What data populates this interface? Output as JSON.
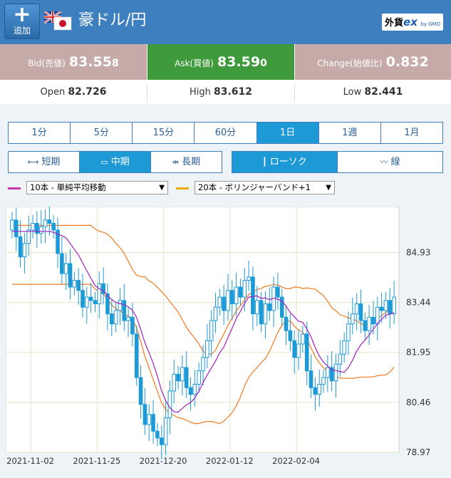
{
  "header": {
    "add_label": "追加",
    "pair_title": "豪ドル/円",
    "logo_main": "外貨",
    "logo_ex": "ex",
    "logo_sub": "by GMO"
  },
  "quote": {
    "bid_label": "Bid(売値)",
    "bid_main": "83.55",
    "bid_small": "8",
    "ask_label": "Ask(買値)",
    "ask_main": "83.59",
    "ask_small": "0",
    "change_label": "Change(始値比)",
    "change_value": "0.832"
  },
  "ohl": {
    "open_label": "Open",
    "open_value": "82.726",
    "high_label": "High",
    "high_value": "83.612",
    "low_label": "Low",
    "low_value": "82.441"
  },
  "timeframes": [
    "1分",
    "5分",
    "15分",
    "60分",
    "1日",
    "1週",
    "1月"
  ],
  "active_timeframe": 4,
  "spans": [
    "短期",
    "中期",
    "長期"
  ],
  "active_span": 1,
  "styles": [
    "ローソク",
    "線"
  ],
  "active_style": 0,
  "indicators": {
    "ma_label": "10本 - 単純平均移動",
    "bb_label": "20本 - ボリンジャーバンド+1",
    "ma_color": "#cc33aa",
    "bb_color": "#f0a800"
  },
  "colors": {
    "header_blue": "#3d7fbf",
    "bid_bg": "#c6aaa8",
    "ask_bg": "#3e9a3a",
    "active_blue": "#1d9ad6",
    "candle": "#1d9ad6",
    "ma_line": "#a020c0",
    "bb_line": "#f07a20"
  },
  "chart_data": {
    "type": "candlestick",
    "y_ticks": [
      "84.93",
      "83.44",
      "81.95",
      "80.46",
      "78.97"
    ],
    "x_ticks": [
      "2021-11-02",
      "2021-11-25",
      "2021-12-20",
      "2022-01-12",
      "2022-02-04"
    ],
    "ylim": [
      78.97,
      86.3
    ],
    "closes": [
      85.9,
      85.4,
      84.8,
      85.2,
      85.6,
      85.8,
      85.5,
      85.7,
      85.9,
      85.8,
      85.6,
      84.9,
      84.3,
      84.6,
      83.9,
      84.1,
      83.8,
      83.3,
      83.6,
      83.5,
      83.4,
      84.0,
      83.7,
      83.1,
      82.8,
      83.2,
      83.5,
      82.9,
      83.0,
      82.5,
      81.2,
      80.4,
      79.8,
      80.1,
      79.6,
      79.4,
      79.2,
      80.0,
      80.8,
      81.3,
      81.1,
      81.5,
      80.9,
      80.7,
      81.0,
      81.4,
      81.8,
      82.3,
      82.9,
      83.3,
      83.6,
      83.2,
      83.8,
      83.4,
      83.9,
      83.6,
      84.1,
      84.2,
      83.1,
      83.5,
      82.8,
      83.4,
      83.2,
      83.9,
      83.6,
      83.0,
      82.6,
      82.3,
      81.8,
      82.2,
      82.5,
      81.4,
      80.9,
      80.7,
      81.0,
      81.2,
      81.5,
      81.1,
      81.6,
      81.9,
      82.3,
      82.8,
      83.1,
      83.4,
      82.9,
      82.6,
      83.0,
      82.8,
      83.3,
      83.2,
      83.5,
      83.1,
      83.6
    ]
  }
}
